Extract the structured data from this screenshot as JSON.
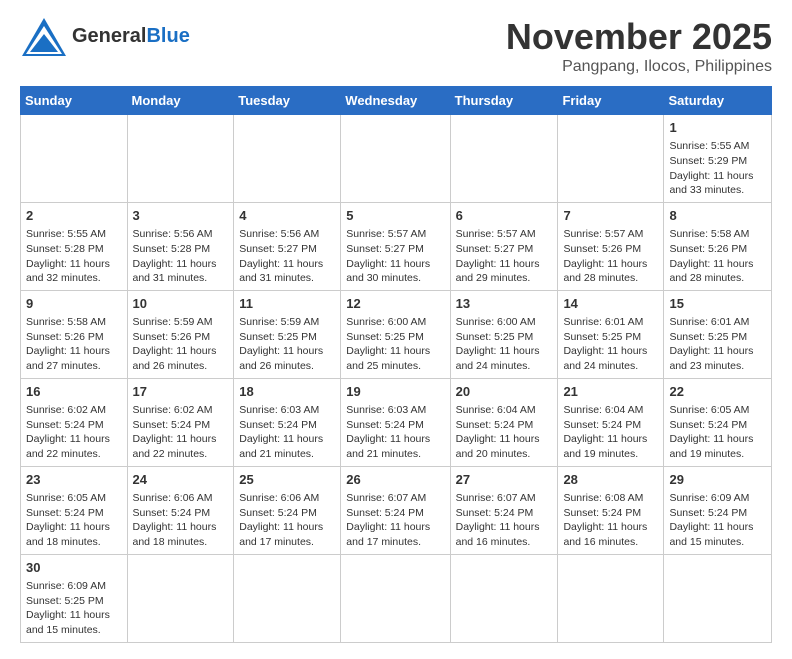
{
  "header": {
    "logo_general": "General",
    "logo_blue": "Blue",
    "month_title": "November 2025",
    "location": "Pangpang, Ilocos, Philippines"
  },
  "weekdays": [
    "Sunday",
    "Monday",
    "Tuesday",
    "Wednesday",
    "Thursday",
    "Friday",
    "Saturday"
  ],
  "weeks": [
    [
      {
        "day": "",
        "info": ""
      },
      {
        "day": "",
        "info": ""
      },
      {
        "day": "",
        "info": ""
      },
      {
        "day": "",
        "info": ""
      },
      {
        "day": "",
        "info": ""
      },
      {
        "day": "",
        "info": ""
      },
      {
        "day": "1",
        "info": "Sunrise: 5:55 AM\nSunset: 5:29 PM\nDaylight: 11 hours\nand 33 minutes."
      }
    ],
    [
      {
        "day": "2",
        "info": "Sunrise: 5:55 AM\nSunset: 5:28 PM\nDaylight: 11 hours\nand 32 minutes."
      },
      {
        "day": "3",
        "info": "Sunrise: 5:56 AM\nSunset: 5:28 PM\nDaylight: 11 hours\nand 31 minutes."
      },
      {
        "day": "4",
        "info": "Sunrise: 5:56 AM\nSunset: 5:27 PM\nDaylight: 11 hours\nand 31 minutes."
      },
      {
        "day": "5",
        "info": "Sunrise: 5:57 AM\nSunset: 5:27 PM\nDaylight: 11 hours\nand 30 minutes."
      },
      {
        "day": "6",
        "info": "Sunrise: 5:57 AM\nSunset: 5:27 PM\nDaylight: 11 hours\nand 29 minutes."
      },
      {
        "day": "7",
        "info": "Sunrise: 5:57 AM\nSunset: 5:26 PM\nDaylight: 11 hours\nand 28 minutes."
      },
      {
        "day": "8",
        "info": "Sunrise: 5:58 AM\nSunset: 5:26 PM\nDaylight: 11 hours\nand 28 minutes."
      }
    ],
    [
      {
        "day": "9",
        "info": "Sunrise: 5:58 AM\nSunset: 5:26 PM\nDaylight: 11 hours\nand 27 minutes."
      },
      {
        "day": "10",
        "info": "Sunrise: 5:59 AM\nSunset: 5:26 PM\nDaylight: 11 hours\nand 26 minutes."
      },
      {
        "day": "11",
        "info": "Sunrise: 5:59 AM\nSunset: 5:25 PM\nDaylight: 11 hours\nand 26 minutes."
      },
      {
        "day": "12",
        "info": "Sunrise: 6:00 AM\nSunset: 5:25 PM\nDaylight: 11 hours\nand 25 minutes."
      },
      {
        "day": "13",
        "info": "Sunrise: 6:00 AM\nSunset: 5:25 PM\nDaylight: 11 hours\nand 24 minutes."
      },
      {
        "day": "14",
        "info": "Sunrise: 6:01 AM\nSunset: 5:25 PM\nDaylight: 11 hours\nand 24 minutes."
      },
      {
        "day": "15",
        "info": "Sunrise: 6:01 AM\nSunset: 5:25 PM\nDaylight: 11 hours\nand 23 minutes."
      }
    ],
    [
      {
        "day": "16",
        "info": "Sunrise: 6:02 AM\nSunset: 5:24 PM\nDaylight: 11 hours\nand 22 minutes."
      },
      {
        "day": "17",
        "info": "Sunrise: 6:02 AM\nSunset: 5:24 PM\nDaylight: 11 hours\nand 22 minutes."
      },
      {
        "day": "18",
        "info": "Sunrise: 6:03 AM\nSunset: 5:24 PM\nDaylight: 11 hours\nand 21 minutes."
      },
      {
        "day": "19",
        "info": "Sunrise: 6:03 AM\nSunset: 5:24 PM\nDaylight: 11 hours\nand 21 minutes."
      },
      {
        "day": "20",
        "info": "Sunrise: 6:04 AM\nSunset: 5:24 PM\nDaylight: 11 hours\nand 20 minutes."
      },
      {
        "day": "21",
        "info": "Sunrise: 6:04 AM\nSunset: 5:24 PM\nDaylight: 11 hours\nand 19 minutes."
      },
      {
        "day": "22",
        "info": "Sunrise: 6:05 AM\nSunset: 5:24 PM\nDaylight: 11 hours\nand 19 minutes."
      }
    ],
    [
      {
        "day": "23",
        "info": "Sunrise: 6:05 AM\nSunset: 5:24 PM\nDaylight: 11 hours\nand 18 minutes."
      },
      {
        "day": "24",
        "info": "Sunrise: 6:06 AM\nSunset: 5:24 PM\nDaylight: 11 hours\nand 18 minutes."
      },
      {
        "day": "25",
        "info": "Sunrise: 6:06 AM\nSunset: 5:24 PM\nDaylight: 11 hours\nand 17 minutes."
      },
      {
        "day": "26",
        "info": "Sunrise: 6:07 AM\nSunset: 5:24 PM\nDaylight: 11 hours\nand 17 minutes."
      },
      {
        "day": "27",
        "info": "Sunrise: 6:07 AM\nSunset: 5:24 PM\nDaylight: 11 hours\nand 16 minutes."
      },
      {
        "day": "28",
        "info": "Sunrise: 6:08 AM\nSunset: 5:24 PM\nDaylight: 11 hours\nand 16 minutes."
      },
      {
        "day": "29",
        "info": "Sunrise: 6:09 AM\nSunset: 5:24 PM\nDaylight: 11 hours\nand 15 minutes."
      }
    ],
    [
      {
        "day": "30",
        "info": "Sunrise: 6:09 AM\nSunset: 5:25 PM\nDaylight: 11 hours\nand 15 minutes."
      },
      {
        "day": "",
        "info": ""
      },
      {
        "day": "",
        "info": ""
      },
      {
        "day": "",
        "info": ""
      },
      {
        "day": "",
        "info": ""
      },
      {
        "day": "",
        "info": ""
      },
      {
        "day": "",
        "info": ""
      }
    ]
  ]
}
